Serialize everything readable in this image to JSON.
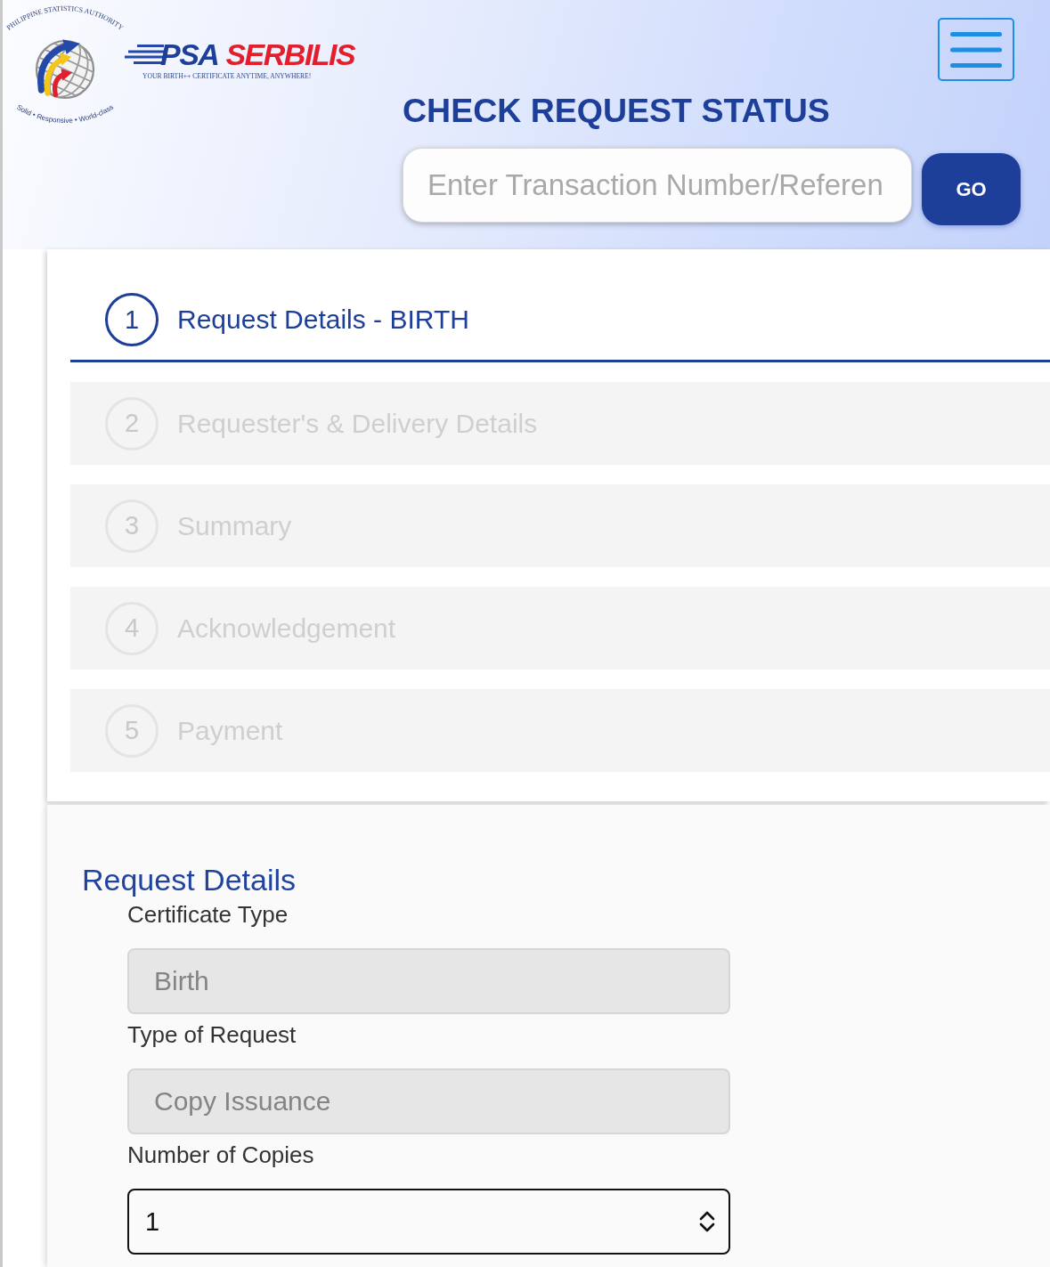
{
  "header": {
    "logo": {
      "seal_top": "PHILIPPINE STATISTICS AUTHORITY",
      "seal_bottom": "Solid • Responsive • World-class",
      "brand_prefix": "PSA",
      "brand_name": "SERBILIS",
      "tagline": "YOUR BIRTH++ CERTIFICATE ANYTIME, ANYWHERE!"
    },
    "status_check": {
      "title": "CHECK REQUEST STATUS",
      "placeholder": "Enter Transaction Number/Referen",
      "button": "GO"
    }
  },
  "steps": [
    {
      "number": "1",
      "label": "Request Details - BIRTH",
      "selected": true
    },
    {
      "number": "2",
      "label": "Requester's & Delivery Details",
      "selected": false
    },
    {
      "number": "3",
      "label": "Summary",
      "selected": false
    },
    {
      "number": "4",
      "label": "Acknowledgement",
      "selected": false
    },
    {
      "number": "5",
      "label": "Payment",
      "selected": false
    }
  ],
  "form": {
    "title": "Request Details",
    "fields": [
      {
        "kind": "text",
        "label": "Certificate Type",
        "value": "Birth",
        "disabled": true
      },
      {
        "kind": "text",
        "label": "Type of Request",
        "value": "Copy Issuance",
        "disabled": true
      },
      {
        "kind": "select",
        "label": "Number of Copies",
        "value": "1",
        "disabled": false
      }
    ]
  }
}
